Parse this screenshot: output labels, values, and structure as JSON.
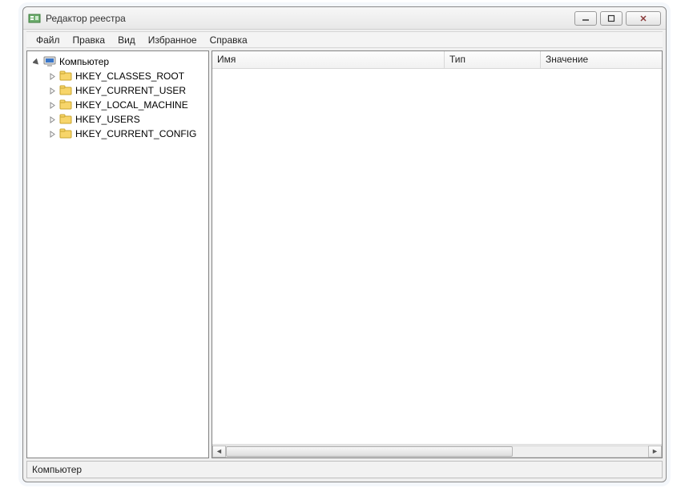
{
  "window": {
    "title": "Редактор реестра"
  },
  "menu": {
    "file": "Файл",
    "edit": "Правка",
    "view": "Вид",
    "favorites": "Избранное",
    "help": "Справка"
  },
  "tree": {
    "root": "Компьютер",
    "keys": [
      "HKEY_CLASSES_ROOT",
      "HKEY_CURRENT_USER",
      "HKEY_LOCAL_MACHINE",
      "HKEY_USERS",
      "HKEY_CURRENT_CONFIG"
    ]
  },
  "columns": {
    "name": "Имя",
    "type": "Тип",
    "value": "Значение"
  },
  "statusbar": {
    "path": "Компьютер"
  }
}
